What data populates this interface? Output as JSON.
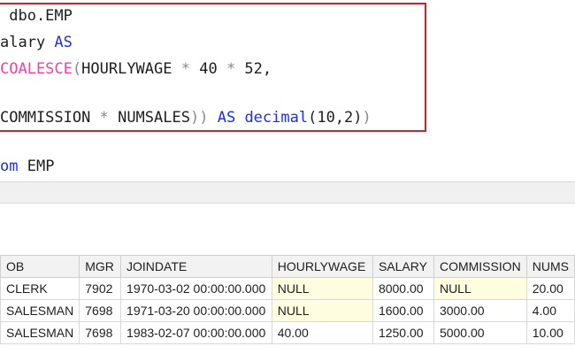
{
  "editor": {
    "line1": {
      "text": " dbo.EMP"
    },
    "line2": {
      "text": "alary ",
      "kw": "AS"
    },
    "line3": {
      "fn": "COALESCE",
      "paren": "(",
      "ident": "HOURLYWAGE ",
      "op1": "*",
      "n1": " 40 ",
      "op2": "*",
      "n2": " 52,"
    },
    "line5": {
      "ident": "COMMISSION ",
      "op": "*",
      "ident2": " NUMSALES",
      "close": "))",
      "sp": " ",
      "kw": "AS",
      "sp2": " ",
      "kw2": "decimal",
      "args": "(10,2)",
      "close2": ")"
    },
    "line7": {
      "kw": "om",
      "text": " EMP"
    }
  },
  "results": {
    "columns": [
      "OB",
      "MGR",
      "JOINDATE",
      "HOURLYWAGE",
      "SALARY",
      "COMMISSION",
      "NUMS"
    ],
    "rows": [
      [
        "CLERK",
        "7902",
        "1970-03-02 00:00:00.000",
        "NULL",
        "8000.00",
        "NULL",
        "20.00"
      ],
      [
        "SALESMAN",
        "7698",
        "1971-03-20 00:00:00.000",
        "NULL",
        "1600.00",
        "3000.00",
        "4.00"
      ],
      [
        "SALESMAN",
        "7698",
        "1983-02-07 00:00:00.000",
        "40.00",
        "1250.00",
        "5000.00",
        "10.00"
      ]
    ]
  }
}
